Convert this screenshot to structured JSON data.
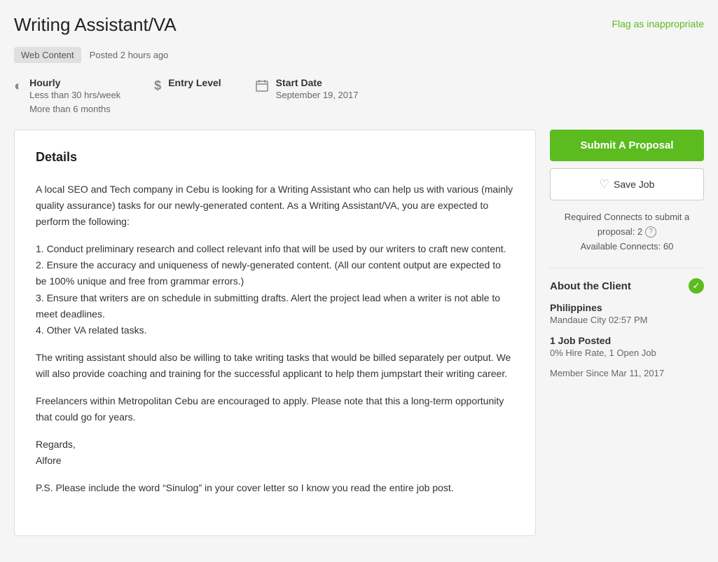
{
  "header": {
    "title": "Writing Assistant/VA",
    "flag_label": "Flag as inappropriate"
  },
  "meta": {
    "tag": "Web Content",
    "posted": "Posted 2 hours ago"
  },
  "info_bar": {
    "hourly": {
      "icon": "clock",
      "label": "Hourly",
      "line1": "Less than 30 hrs/week",
      "line2": "More than 6 months"
    },
    "level": {
      "icon": "dollar",
      "label": "Entry Level"
    },
    "start_date": {
      "icon": "calendar",
      "label": "Start Date",
      "value": "September 19, 2017"
    }
  },
  "details": {
    "heading": "Details",
    "paragraphs": [
      "A local SEO and Tech company in Cebu is looking for a Writing Assistant who can help us with various (mainly quality assurance) tasks for our newly-generated content. As a Writing Assistant/VA, you are expected to perform the following:",
      "1. Conduct preliminary research and collect relevant info that will be used by our writers to craft new content.\n2. Ensure the accuracy and uniqueness of newly-generated content. (All our content output are expected to be 100% unique and free from grammar errors.)\n3. Ensure that writers are on schedule in submitting drafts. Alert the project lead when a writer is not able to meet deadlines.\n4. Other VA related tasks.",
      "The writing assistant should also be willing to take writing tasks that would be billed separately per output. We will also provide coaching and training for the successful applicant to help them jumpstart their writing career.",
      "Freelancers within Metropolitan Cebu are encouraged to apply. Please note that this a long-term opportunity that could go for years.",
      "Regards,\nAlfore",
      "P.S. Please include the word “Sinulog” in your cover letter so I know you read the entire job post."
    ]
  },
  "sidebar": {
    "submit_label": "Submit A Proposal",
    "save_label": "Save Job",
    "connects": {
      "line1": "Required Connects to submit a",
      "line2": "proposal: 2",
      "line3": "Available Connects: 60"
    },
    "client": {
      "section_title": "About the Client",
      "country": "Philippines",
      "city_time": "Mandaue City 02:57 PM",
      "jobs_label": "1 Job Posted",
      "hire_rate": "0% Hire Rate, 1 Open Job",
      "member_since": "Member Since Mar 11, 2017"
    }
  }
}
